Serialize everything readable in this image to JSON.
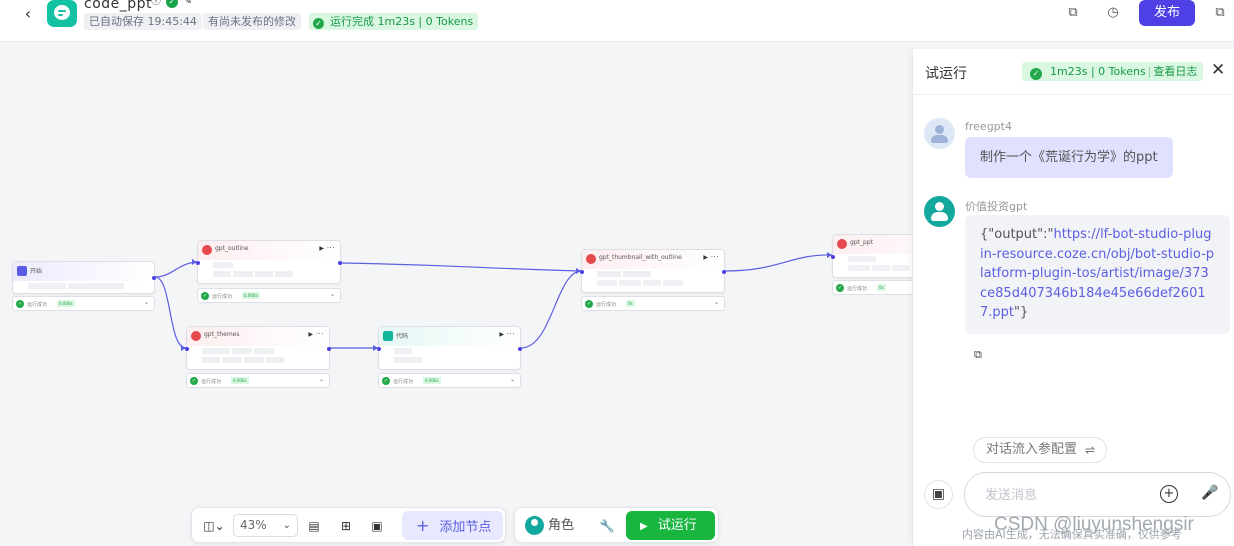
{
  "header": {
    "back_icon": "chevron-left-icon",
    "app_name": "code_ppt",
    "autosave": "已自动保存 19:45:44",
    "unpublished": "有尚未发布的修改",
    "run_status": "运行完成 1m23s | 0 Tokens",
    "publish_label": "发布"
  },
  "canvas": {
    "nodes": [
      {
        "id": "start",
        "title": "开始",
        "status": "运行成功",
        "badge": "0.000s",
        "type": "start"
      },
      {
        "id": "gpt_outline",
        "title": "gpt_outline",
        "status": "运行成功",
        "badge": "0.000s",
        "type": "llm"
      },
      {
        "id": "gpt_themes",
        "title": "gpt_themes",
        "status": "运行成功",
        "badge": "0.000s",
        "type": "llm"
      },
      {
        "id": "code",
        "title": "代码",
        "status": "运行成功",
        "badge": "0.000s",
        "type": "code"
      },
      {
        "id": "gpt_thumbnail_with_outline",
        "title": "gpt_thumbnail_with_outline",
        "status": "运行成功",
        "badge": "0s",
        "type": "llm"
      },
      {
        "id": "gpt_ppt",
        "title": "gpt_ppt",
        "status": "运行成功",
        "badge": "0s",
        "type": "llm"
      }
    ]
  },
  "toolbar": {
    "zoom": "43%",
    "add_node": "添加节点",
    "role": "角色",
    "trial_run": "试运行"
  },
  "panel": {
    "title": "试运行",
    "run_summary": "1m23s | 0 Tokens",
    "view_log": "查看日志",
    "user_name": "freegpt4",
    "user_message": "制作一个《荒诞行为学》的ppt",
    "bot_name": "价值投资gpt",
    "bot_message_prefix": "{\"output\":\"",
    "bot_message_url": "https://lf-bot-studio-plugin-resource.coze.cn/obj/bot-studio-platform-plugin-tos/artist/image/373ce85d407346b184e45e66def26017.ppt",
    "bot_message_suffix": "\"}",
    "config_label": "对话流入参配置",
    "input_placeholder": "发送消息",
    "footer_note": "内容由AI生成，无法确保真实准确，仅供参考"
  },
  "watermark": "CSDN @liuyunshengsir",
  "colors": {
    "accent": "#4e40e5",
    "success": "#22a74a",
    "teal": "#13a89e",
    "run_green": "#18b63f"
  }
}
